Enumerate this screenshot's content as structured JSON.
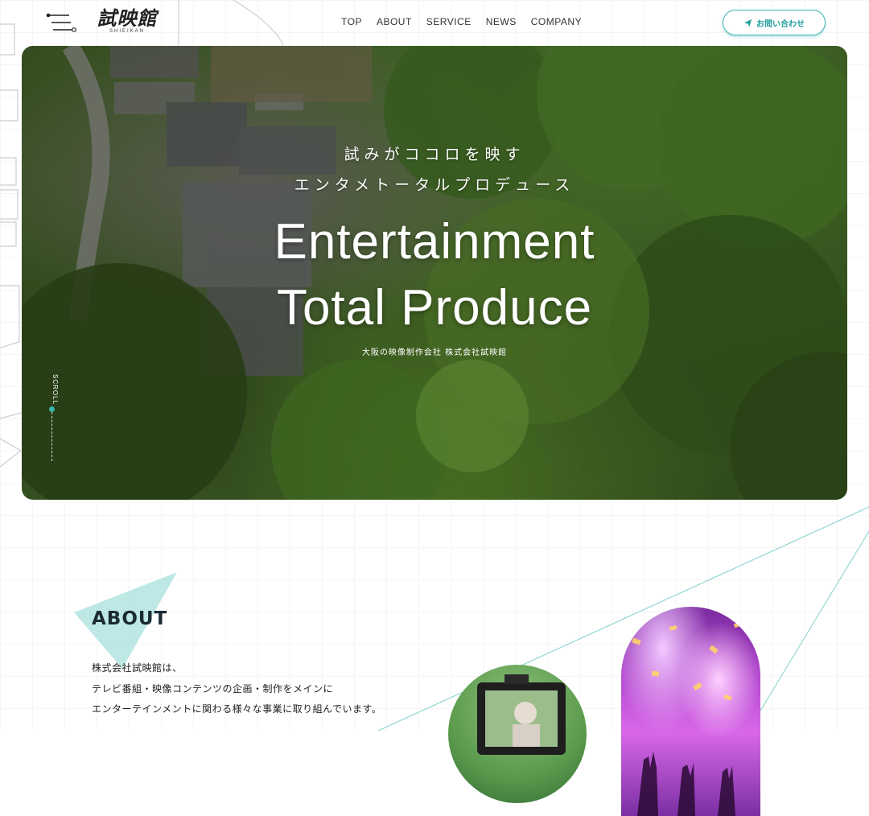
{
  "header": {
    "logo": {
      "mark": "試映館",
      "sub": "SHIEIKAN"
    },
    "nav": [
      {
        "label": "TOP"
      },
      {
        "label": "ABOUT"
      },
      {
        "label": "SERVICE"
      },
      {
        "label": "NEWS"
      },
      {
        "label": "COMPANY"
      }
    ],
    "contact_label": "お問い合わせ"
  },
  "hero": {
    "jp_line1": "試みがココロを映す",
    "jp_line2": "エンタメトータルプロデュース",
    "en_line1": "Entertainment",
    "en_line2": "Total Produce",
    "subtitle": "大阪の映像制作会社 株式会社試映館",
    "scroll_label": "SCROLL"
  },
  "about": {
    "title": "ABOUT",
    "lines": [
      "株式会社試映館は、",
      "テレビ番組・映像コンテンツの企画・制作をメインに",
      "エンターテインメントに関わる様々な事業に取り組んでいます。"
    ]
  },
  "colors": {
    "accent": "#3bb3b0",
    "accent_dark": "#1f9e9b",
    "title": "#1c2a33"
  },
  "icons": {
    "menu": "menu-icon",
    "send": "paper-plane-icon"
  }
}
